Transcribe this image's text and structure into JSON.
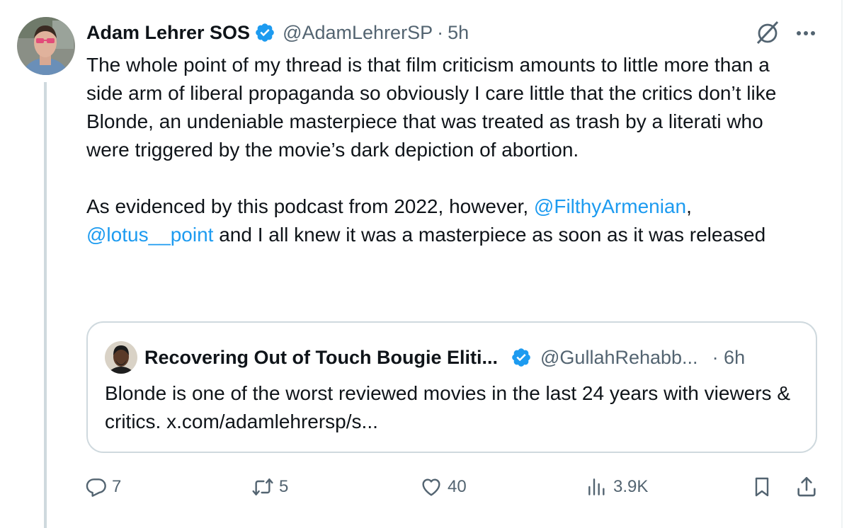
{
  "tweet": {
    "author_name": "Adam Lehrer SOS",
    "author_handle": "@AdamLehrerSP",
    "separator": "·",
    "time": "5h",
    "more_glyph": "···",
    "text_line_1": "The whole point of my thread is that film criticism amounts to little more than a side arm of liberal propaganda so obviously I care little that the critics don’t like Blonde, an undeniable masterpiece that was treated as trash by a literati who were triggered by the movie’s dark depiction of abortion.",
    "text_line_2_prefix": "As evidenced by this podcast from 2022, however, ",
    "mention_1": "@FilthyArmenian",
    "text_line_2_mid": ", ",
    "mention_2": "@lotus__point",
    "text_line_2_suffix": " and I all knew it was a masterpiece as soon as it was released"
  },
  "quote": {
    "author_name": "Recovering Out of Touch Bougie Eliti...",
    "author_handle": "@GullahRehabb...",
    "time": "· 6h",
    "text": "Blonde is one of the worst reviewed movies in the last 24 years with viewers & critics. x.com/adamlehrersp/s..."
  },
  "actions": {
    "replies": "7",
    "reposts": "5",
    "likes": "40",
    "views": "3.9K"
  },
  "colors": {
    "link": "#1d9bf0",
    "verified": "#1d9bf0",
    "secondary_text": "#536471",
    "border": "#cfd9de"
  },
  "icons": [
    "verified-badge-icon",
    "grok-icon",
    "more-icon",
    "reply-icon",
    "repost-icon",
    "like-icon",
    "views-icon",
    "bookmark-icon",
    "share-icon"
  ]
}
